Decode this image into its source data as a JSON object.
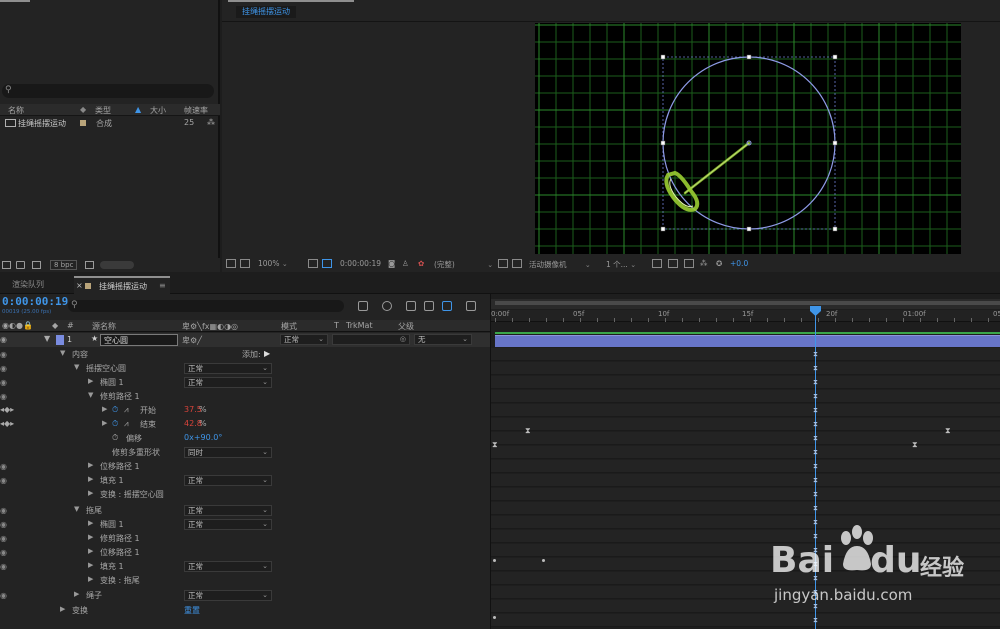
{
  "project": {
    "columns": [
      "名称",
      "类型",
      "大小",
      "帧速率"
    ],
    "item": {
      "name": "挂绳摇摆运动",
      "type": "合成",
      "fps": "25"
    },
    "bpc": "8 bpc"
  },
  "viewer": {
    "comp_tab": "挂绳摇摆运动",
    "zoom": "100%",
    "timecode": "0:00:00:19",
    "resolution": "(完整)",
    "camera": "活动摄像机",
    "views": "1 个...",
    "exposure": "+0.0"
  },
  "timeline": {
    "tabs": {
      "render_queue": "渲染队列",
      "comp": "挂绳摇摆运动"
    },
    "menu_glyph": "≡",
    "close_glyph": "×",
    "timecode": "0:00:00:19",
    "frame_info": "00019 (25.00 fps)",
    "columns": {
      "num": "#",
      "source_name": "源名称",
      "mode": "模式",
      "t": "T",
      "trkmat": "TrkMat",
      "parent": "父级"
    },
    "layer": {
      "num": "1",
      "name": "空心圆",
      "mode": "正常",
      "parent": "无"
    },
    "contents_label": "内容",
    "add_label": "添加:",
    "props": [
      {
        "label": "摇摆空心圆",
        "dropdown": "正常"
      },
      {
        "label": "椭圆 1",
        "dropdown": "正常"
      },
      {
        "label": "修剪路径 1"
      },
      {
        "label": "开始",
        "value": "37.5",
        "unit": "%"
      },
      {
        "label": "结束",
        "value": "42.8",
        "unit": "%"
      },
      {
        "label": "偏移",
        "value": "0x+90.0°"
      },
      {
        "label": "修剪多重形状",
        "dropdown": "同时"
      },
      {
        "label": "位移路径 1"
      },
      {
        "label": "填充 1",
        "dropdown": "正常"
      },
      {
        "label": "变换 : 摇摆空心圆"
      },
      {
        "label": "拖尾",
        "dropdown": "正常"
      },
      {
        "label": "椭圆 1",
        "dropdown": "正常"
      },
      {
        "label": "修剪路径 1"
      },
      {
        "label": "位移路径 1"
      },
      {
        "label": "填充 1",
        "dropdown": "正常"
      },
      {
        "label": "变换 : 拖尾"
      },
      {
        "label": "绳子",
        "dropdown": "正常"
      },
      {
        "label": "变换",
        "value": "重置"
      }
    ],
    "ruler": [
      "0:00f",
      "05f",
      "10f",
      "15f",
      "20f",
      "01:00f",
      "05"
    ]
  },
  "watermark": {
    "brand": "Bai",
    "brand2": "du",
    "cn": "经验",
    "url": "jingyan.baidu.com"
  },
  "colors": {
    "accent": "#3f95e8",
    "layer_bar": "#6775c8",
    "green": "#3aa64a",
    "stroke_green": "#9acd32",
    "red_value": "#d8433a"
  }
}
